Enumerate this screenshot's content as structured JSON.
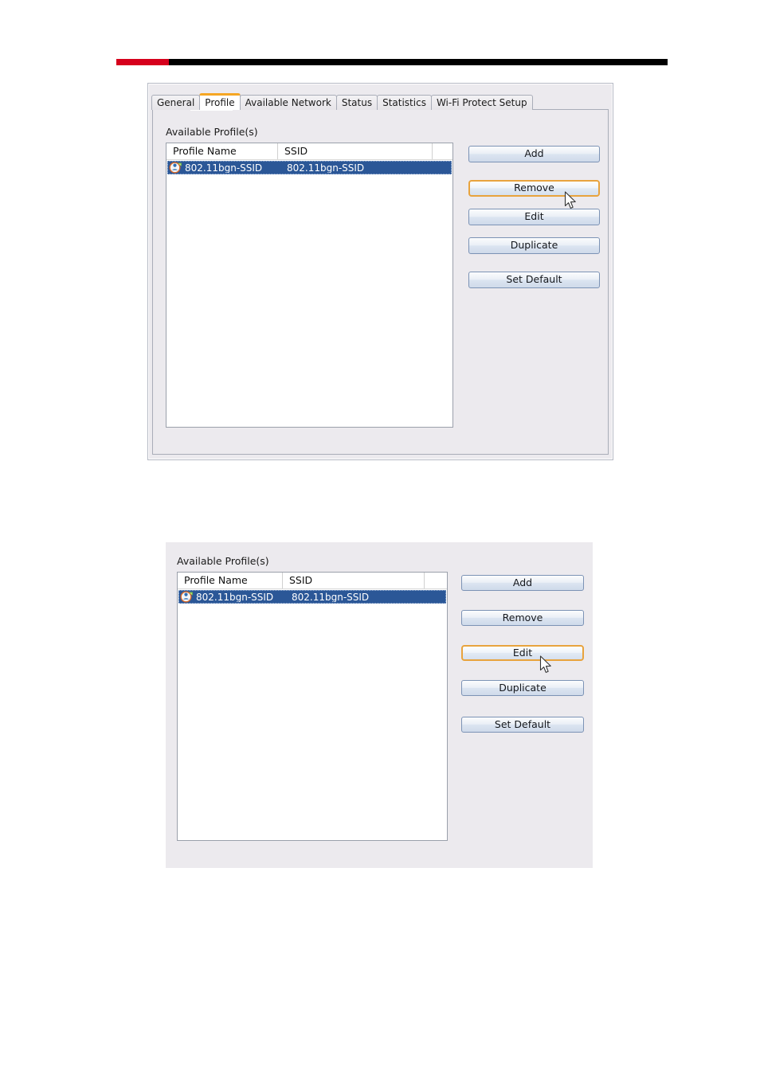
{
  "header_rule": {
    "red_color": "#d6001c",
    "black_color": "#000000"
  },
  "dialog": {
    "tabs": [
      {
        "label": "General",
        "active": false
      },
      {
        "label": "Profile",
        "active": true
      },
      {
        "label": "Available Network",
        "active": false
      },
      {
        "label": "Status",
        "active": false
      },
      {
        "label": "Statistics",
        "active": false
      },
      {
        "label": "Wi-Fi Protect Setup",
        "active": false
      }
    ],
    "group_caption": "Available Profile(s)",
    "list": {
      "columns": [
        "Profile Name",
        "SSID",
        ""
      ],
      "rows": [
        {
          "icon": "wireless-profile-icon",
          "profile_name": "802.11bgn-SSID",
          "ssid": "802.11bgn-SSID",
          "selected": true
        }
      ]
    },
    "buttons": [
      {
        "label": "Add",
        "highlighted": false
      },
      {
        "label": "Remove",
        "highlighted": true
      },
      {
        "label": "Edit",
        "highlighted": false
      },
      {
        "label": "Duplicate",
        "highlighted": false
      },
      {
        "label": "Set Default",
        "highlighted": false
      }
    ],
    "cursor": {
      "over": "Remove"
    }
  },
  "panel2": {
    "group_caption": "Available Profile(s)",
    "list": {
      "columns": [
        "Profile Name",
        "SSID",
        ""
      ],
      "rows": [
        {
          "icon": "wireless-profile-icon",
          "profile_name": "802.11bgn-SSID",
          "ssid": "802.11bgn-SSID",
          "selected": true
        }
      ]
    },
    "buttons": [
      {
        "label": "Add",
        "highlighted": false
      },
      {
        "label": "Remove",
        "highlighted": false
      },
      {
        "label": "Edit",
        "highlighted": true
      },
      {
        "label": "Duplicate",
        "highlighted": false
      },
      {
        "label": "Set Default",
        "highlighted": false
      }
    ],
    "cursor": {
      "over": "Edit"
    }
  },
  "colors": {
    "selection_blue": "#2b5797",
    "highlight_orange": "#e8a33d",
    "panel_gray": "#eceaee",
    "accent_red": "#d6001c"
  }
}
